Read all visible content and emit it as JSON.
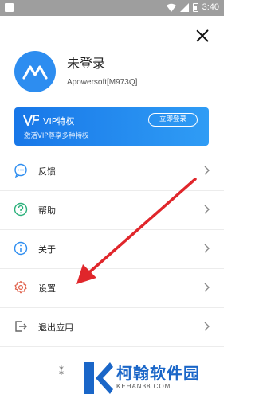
{
  "status_bar": {
    "time": "3:40"
  },
  "profile": {
    "name": "未登录",
    "account_id": "Apowersoft[M973Q]"
  },
  "vip": {
    "title": "VIP特权",
    "subtitle": "激活VIP尊享多种特权",
    "login_button": "立即登录"
  },
  "menu": [
    {
      "label": "反馈",
      "icon": "feedback-icon"
    },
    {
      "label": "帮助",
      "icon": "help-icon"
    },
    {
      "label": "关于",
      "icon": "info-icon"
    },
    {
      "label": "设置",
      "icon": "gear-icon"
    },
    {
      "label": "退出应用",
      "icon": "exit-icon"
    }
  ],
  "watermark": {
    "name": "柯翰软件园",
    "url": "KEHAN38.COM"
  },
  "colors": {
    "accent": "#2d8df0",
    "arrow": "#e0262b",
    "status_bar": "#9e9e9e"
  }
}
